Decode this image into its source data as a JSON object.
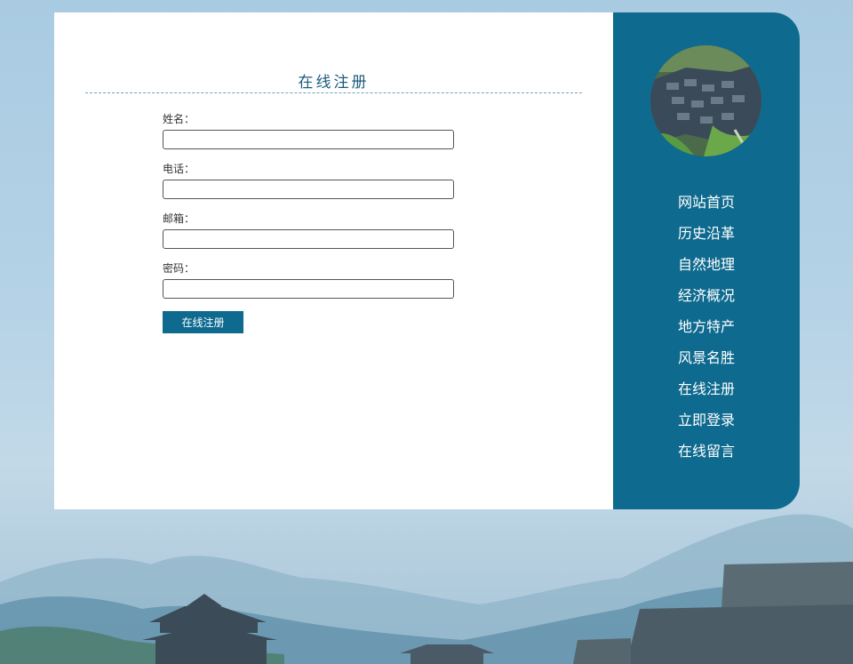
{
  "form": {
    "title": "在线注册",
    "fields": [
      {
        "label": "姓名：",
        "value": ""
      },
      {
        "label": "电话：",
        "value": ""
      },
      {
        "label": "邮箱：",
        "value": ""
      },
      {
        "label": "密码：",
        "value": ""
      }
    ],
    "submit_label": "在线注册"
  },
  "sidebar": {
    "avatar_icon": "village-aerial-photo",
    "items": [
      {
        "label": "网站首页"
      },
      {
        "label": "历史沿革"
      },
      {
        "label": "自然地理"
      },
      {
        "label": "经济概况"
      },
      {
        "label": "地方特产"
      },
      {
        "label": "风景名胜"
      },
      {
        "label": "在线注册"
      },
      {
        "label": "立即登录"
      },
      {
        "label": "在线留言"
      }
    ]
  },
  "colors": {
    "accent": "#0e6a8e",
    "background_sky": "#b5d2e6",
    "panel": "#ffffff"
  }
}
